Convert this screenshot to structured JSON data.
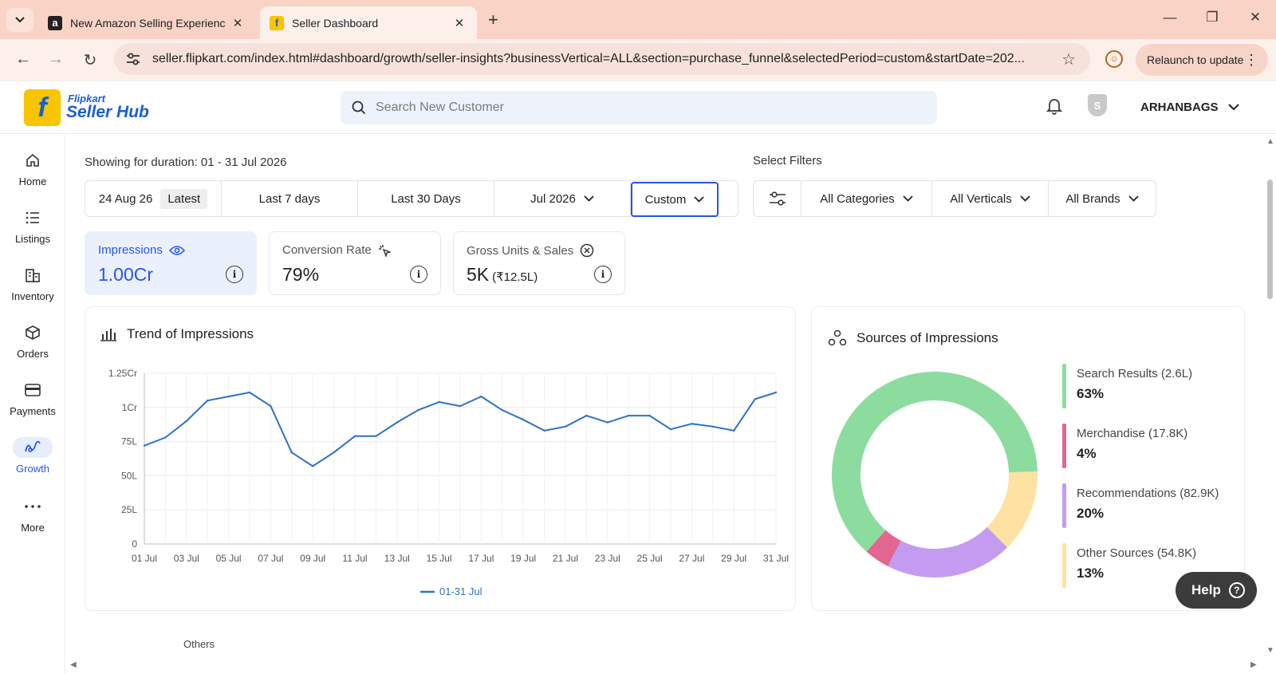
{
  "browser": {
    "tabs": [
      {
        "title": "New Amazon Selling Experienc",
        "favicon": "a"
      },
      {
        "title": "Seller Dashboard",
        "favicon": "f"
      }
    ],
    "url": "seller.flipkart.com/index.html#dashboard/growth/seller-insights?businessVertical=ALL&section=purchase_funnel&selectedPeriod=custom&startDate=202...",
    "relaunch_label": "Relaunch to update"
  },
  "header": {
    "brand_small": "Flipkart",
    "brand_big": "Seller Hub",
    "search_placeholder": "Search New Customer",
    "shield_letter": "S",
    "account_name": "ARHANBAGS"
  },
  "sidebar": {
    "items": [
      {
        "label": "Home",
        "icon": "home-icon"
      },
      {
        "label": "Listings",
        "icon": "list-icon"
      },
      {
        "label": "Inventory",
        "icon": "warehouse-icon"
      },
      {
        "label": "Orders",
        "icon": "box-icon"
      },
      {
        "label": "Payments",
        "icon": "card-icon"
      },
      {
        "label": "Growth",
        "icon": "growth-icon"
      },
      {
        "label": "More",
        "icon": "more-icon"
      }
    ]
  },
  "duration_text": "Showing for duration: 01 - 31 Jul 2026",
  "select_filters_label": "Select Filters",
  "periods": {
    "latest_date": "24 Aug 26",
    "latest_tag": "Latest",
    "last7": "Last 7 days",
    "last30": "Last 30 Days",
    "month": "Jul 2026",
    "custom": "Custom"
  },
  "filters": {
    "categories": "All Categories",
    "verticals": "All Verticals",
    "brands": "All Brands"
  },
  "kpis": [
    {
      "label": "Impressions",
      "value": "1.00Cr",
      "sub": ""
    },
    {
      "label": "Conversion Rate",
      "value": "79%",
      "sub": ""
    },
    {
      "label": "Gross Units & Sales",
      "value": "5K",
      "sub": "(₹12.5L)"
    }
  ],
  "trend_card": {
    "title": "Trend of Impressions"
  },
  "sources_card": {
    "title": "Sources of Impressions"
  },
  "sources": [
    {
      "name": "Search Results (2.6L)",
      "pct": "63%",
      "value": 63,
      "color": "#8ddc9f"
    },
    {
      "name": "Merchandise (17.8K)",
      "pct": "4%",
      "value": 4,
      "color": "#e2668f"
    },
    {
      "name": "Recommendations (82.9K)",
      "pct": "20%",
      "value": 20,
      "color": "#c39cf2"
    },
    {
      "name": "Other Sources (54.8K)",
      "pct": "13%",
      "value": 13,
      "color": "#fde2a4"
    }
  ],
  "chart_data": {
    "type": "line",
    "title": "Trend of Impressions",
    "x": [
      "01 Jul",
      "02 Jul",
      "03 Jul",
      "04 Jul",
      "05 Jul",
      "06 Jul",
      "07 Jul",
      "08 Jul",
      "09 Jul",
      "10 Jul",
      "11 Jul",
      "12 Jul",
      "13 Jul",
      "14 Jul",
      "15 Jul",
      "16 Jul",
      "17 Jul",
      "18 Jul",
      "19 Jul",
      "20 Jul",
      "21 Jul",
      "22 Jul",
      "23 Jul",
      "24 Jul",
      "25 Jul",
      "26 Jul",
      "27 Jul",
      "28 Jul",
      "29 Jul",
      "30 Jul",
      "31 Jul"
    ],
    "xticks": [
      "01 Jul",
      "03 Jul",
      "05 Jul",
      "07 Jul",
      "09 Jul",
      "11 Jul",
      "13 Jul",
      "15 Jul",
      "17 Jul",
      "19 Jul",
      "21 Jul",
      "23 Jul",
      "25 Jul",
      "27 Jul",
      "29 Jul",
      "31 Jul"
    ],
    "yticks": [
      "0",
      "25L",
      "50L",
      "75L",
      "1Cr",
      "1.25Cr"
    ],
    "ylim": [
      0,
      125
    ],
    "series": [
      {
        "name": "01-31 Jul",
        "color": "#2f72c4",
        "values": [
          72,
          78,
          90,
          105,
          108,
          111,
          101,
          67,
          57,
          67,
          79,
          79,
          89,
          98,
          104,
          101,
          108,
          98,
          91,
          83,
          86,
          94,
          89,
          94,
          94,
          84,
          88,
          86,
          83,
          106,
          111
        ]
      }
    ],
    "grid": true,
    "legend": "bottom-center"
  },
  "others_label": "Others",
  "help_label": "Help"
}
